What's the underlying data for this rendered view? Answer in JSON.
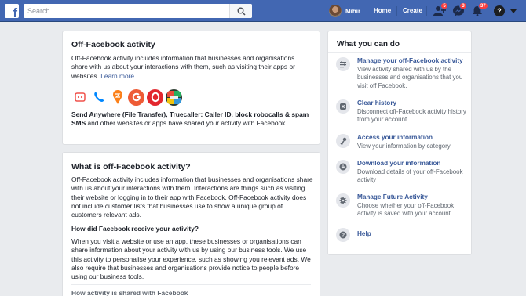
{
  "header": {
    "logo_letter": "f",
    "search_placeholder": "Search",
    "user_name": "Mihir",
    "nav": {
      "home": "Home",
      "create": "Create"
    },
    "badges": {
      "friends": "5",
      "messages": "3",
      "notifications": "37"
    },
    "help_glyph": "?",
    "brand_color": "#4267b2"
  },
  "offfb": {
    "title": "Off-Facebook activity",
    "description": "Off-Facebook activity includes information that businesses and organisations share with us about your interactions with them, such as visiting their apps or websites.",
    "learn_more": "Learn more",
    "apps_bold": "Send Anywhere (File Transfer), Truecaller: Caller ID, block robocalls & spam SMS",
    "apps_rest": " and other websites or apps have shared your activity with Facebook.",
    "app_icons": [
      "send-anywhere-icon",
      "truecaller-icon",
      "swiggy-icon",
      "google-icon",
      "opera-icon",
      "grid-app-icon"
    ]
  },
  "what": {
    "title": "What is off-Facebook activity?",
    "p1": "Off-Facebook activity includes information that businesses and organisations share with us about your interactions with them. Interactions are things such as visiting their website or logging in to their app with Facebook. Off-Facebook activity does not include customer lists that businesses use to show a unique group of customers relevant ads.",
    "h2": "How did Facebook receive your activity?",
    "p2": "When you visit a website or use an app, these businesses or organisations can share information about your activity with us by using our business tools. We use this activity to personalise your experience, such as showing you relevant ads. We also require that businesses and organisations provide notice to people before using our business tools.",
    "h3": "How activity is shared with Facebook"
  },
  "wyc": {
    "title": "What you can do",
    "items": [
      {
        "icon": "manage-icon",
        "title": "Manage your off-Facebook activity",
        "desc": "View activity shared with us by the businesses and organisations that you visit off Facebook."
      },
      {
        "icon": "clear-icon",
        "title": "Clear history",
        "desc": "Disconnect off-Facebook activity history from your account."
      },
      {
        "icon": "key-icon",
        "title": "Access your information",
        "desc": "View your information by category"
      },
      {
        "icon": "download-icon",
        "title": "Download your information",
        "desc": "Download details of your off-Facebook activity"
      },
      {
        "icon": "settings-gear-icon",
        "title": "Manage Future Activity",
        "desc": "Choose whether your off-Facebook activity is saved with your account"
      },
      {
        "icon": "help-icon",
        "title": "Help",
        "desc": ""
      }
    ]
  }
}
